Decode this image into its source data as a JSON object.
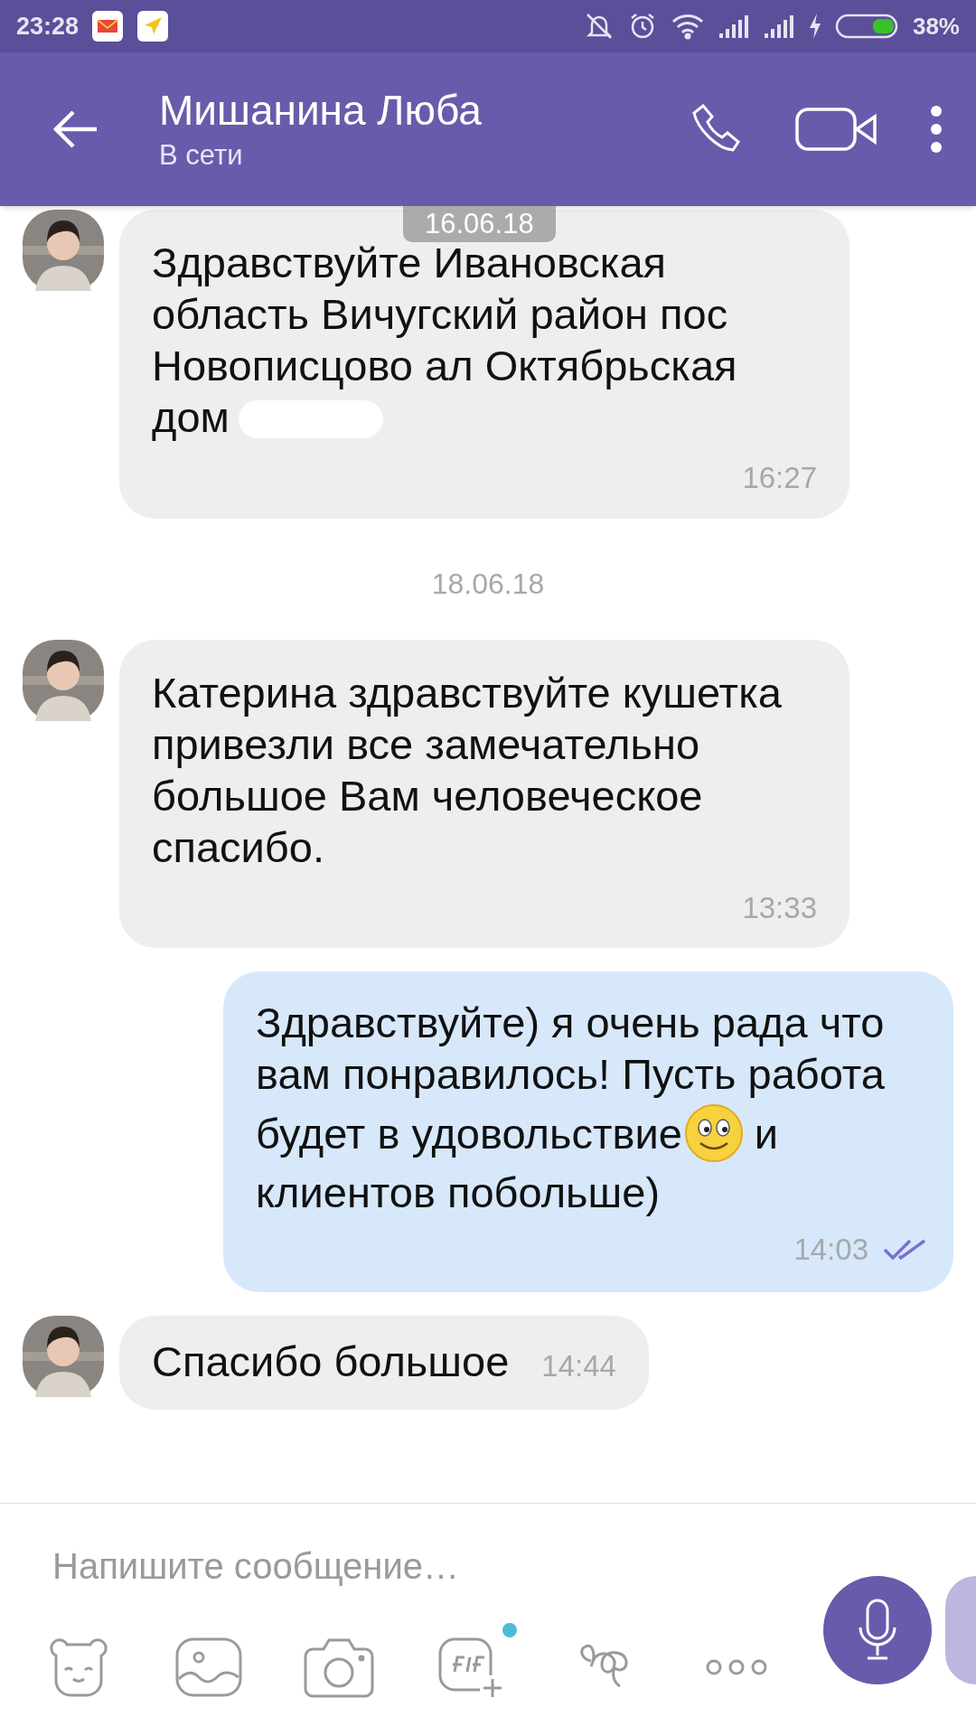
{
  "status_bar": {
    "time": "23:28",
    "battery_percent": "38%"
  },
  "header": {
    "title": "Мишанина Люба",
    "subtitle": "В сети"
  },
  "messages": [
    {
      "kind": "date",
      "text": "16.06.18"
    },
    {
      "kind": "incoming",
      "blocks": [
        [
          {
            "kind": "text",
            "text": "Здравствуйте Ивановская область Вичугский район пос Новописцово ал Октябрьская"
          }
        ],
        [
          {
            "kind": "text",
            "text": "дом"
          },
          {
            "kind": "redacted"
          }
        ]
      ],
      "time": "16:27"
    },
    {
      "kind": "date",
      "text": "18.06.18"
    },
    {
      "kind": "incoming",
      "blocks": [
        [
          {
            "kind": "text",
            "text": "Катерина здравствуйте кушетка привезли все замечательно большое Вам человеческое спасибо."
          }
        ]
      ],
      "time": "13:33"
    },
    {
      "kind": "outgoing",
      "blocks": [
        [
          {
            "kind": "text",
            "text": "Здравствуйте) я очень рада что вам понравилось! Пусть работа"
          }
        ],
        [
          {
            "kind": "text",
            "text": "будет в удовольствие"
          },
          {
            "kind": "emoji"
          },
          {
            "kind": "text",
            "text": "и"
          }
        ],
        [
          {
            "kind": "text",
            "text": "клиентов побольше)"
          }
        ]
      ],
      "time": "14:03",
      "read": true
    },
    {
      "kind": "incoming_short",
      "blocks": [
        [
          {
            "kind": "text",
            "text": "Спасибо большое"
          }
        ]
      ],
      "time": "14:44"
    }
  ],
  "composer": {
    "placeholder": "Напишите сообщение…"
  }
}
